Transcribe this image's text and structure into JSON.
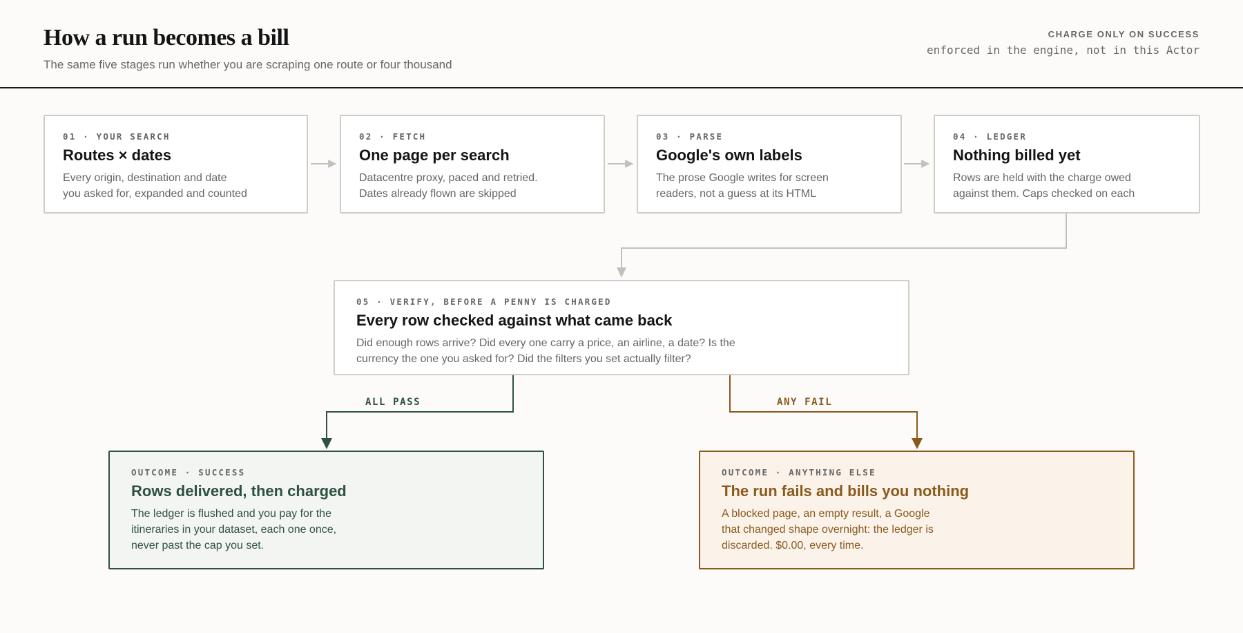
{
  "header": {
    "title": "How a run becomes a bill",
    "subtitle": "The same five stages run whether you are scraping one route or four thousand",
    "kicker": "CHARGE ONLY ON SUCCESS",
    "note": "enforced in the engine, not in this Actor"
  },
  "stages": [
    {
      "step": "01 · YOUR SEARCH",
      "title": "Routes × dates",
      "desc_lines": [
        "Every origin, destination and date",
        "you asked for, expanded and counted"
      ]
    },
    {
      "step": "02 · FETCH",
      "title": "One page per search",
      "desc_lines": [
        "Datacentre proxy, paced and retried.",
        "Dates already flown are skipped"
      ]
    },
    {
      "step": "03 · PARSE",
      "title": "Google's own labels",
      "desc_lines": [
        "The prose Google writes for screen",
        "readers, not a guess at its HTML"
      ]
    },
    {
      "step": "04 · LEDGER",
      "title": "Nothing billed yet",
      "desc_lines": [
        "Rows are held with the charge owed",
        "against them. Caps checked on each"
      ]
    }
  ],
  "verify": {
    "step": "05 · VERIFY, BEFORE A PENNY IS CHARGED",
    "title": "Every row checked against what came back",
    "desc_lines": [
      "Did enough rows arrive? Did every one carry a price, an airline, a date? Is the",
      "currency the one you asked for? Did the filters you set actually filter?"
    ]
  },
  "branches": {
    "pass": "ALL PASS",
    "fail": "ANY FAIL"
  },
  "outcomes": {
    "success": {
      "step": "OUTCOME · SUCCESS",
      "title": "Rows delivered, then charged",
      "desc_lines": [
        "The ledger is flushed and you pay for the",
        "itineraries in your dataset, each one once,",
        "never past the cap you set."
      ]
    },
    "fail": {
      "step": "OUTCOME · ANYTHING ELSE",
      "title": "The run fails and bills you nothing",
      "desc_lines": [
        "A blocked page, an empty result, a Google",
        "that changed shape overnight: the ledger is",
        "discarded. $0.00, every time."
      ]
    }
  },
  "colors": {
    "neutral_line": "#c2c0b8",
    "success": "#2e5240",
    "fail": "#8a5a1d"
  }
}
